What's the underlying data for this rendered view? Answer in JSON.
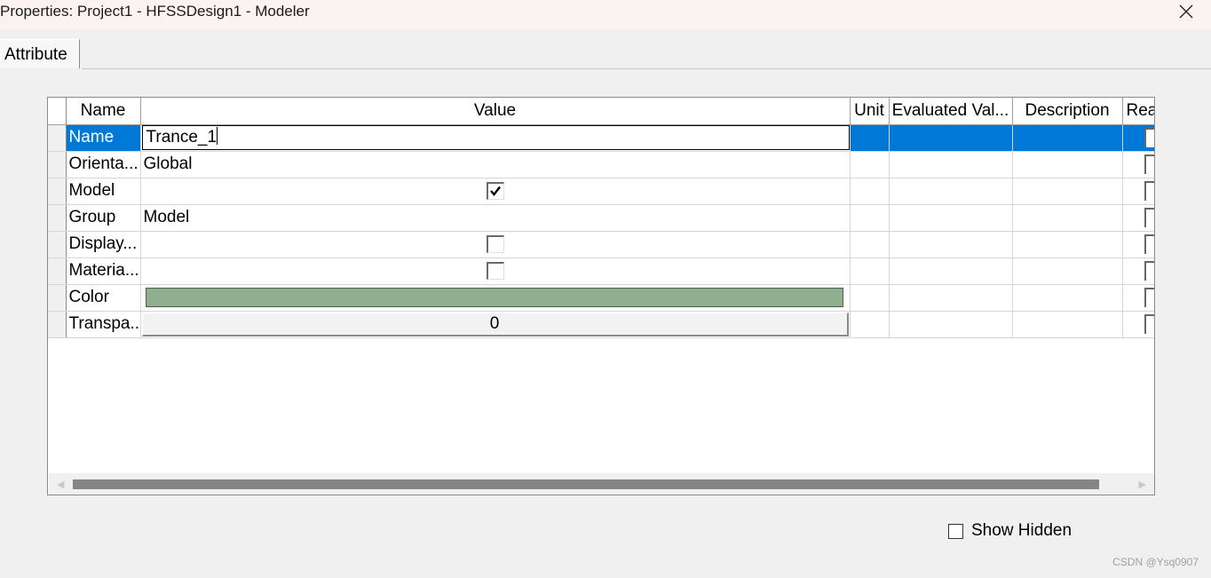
{
  "window": {
    "title": "Properties: Project1 - HFSSDesign1 - Modeler",
    "close_icon": "close-icon"
  },
  "tabs": [
    {
      "label": "Attribute",
      "active": true
    }
  ],
  "grid": {
    "columns": [
      "Name",
      "Value",
      "Unit",
      "Evaluated Val...",
      "Description",
      "Rea"
    ],
    "rows": [
      {
        "name": "Name",
        "value": "Trance_1",
        "type": "text-edit",
        "selected": true
      },
      {
        "name": "Orienta...",
        "value": "Global",
        "type": "text"
      },
      {
        "name": "Model",
        "value": "",
        "type": "checkbox",
        "checked": true
      },
      {
        "name": "Group",
        "value": "Model",
        "type": "text"
      },
      {
        "name": "Display...",
        "value": "",
        "type": "checkbox",
        "checked": false
      },
      {
        "name": "Materia...",
        "value": "",
        "type": "checkbox",
        "checked": false
      },
      {
        "name": "Color",
        "value": "",
        "type": "color",
        "color": "#8faf8f"
      },
      {
        "name": "Transpa...",
        "value": "0",
        "type": "spinner"
      }
    ]
  },
  "show_hidden": {
    "label": "Show Hidden",
    "checked": false
  },
  "watermark": "CSDN @Ysq0907",
  "colors": {
    "selection": "#0078d7",
    "color_swatch": "#8faf8f"
  }
}
